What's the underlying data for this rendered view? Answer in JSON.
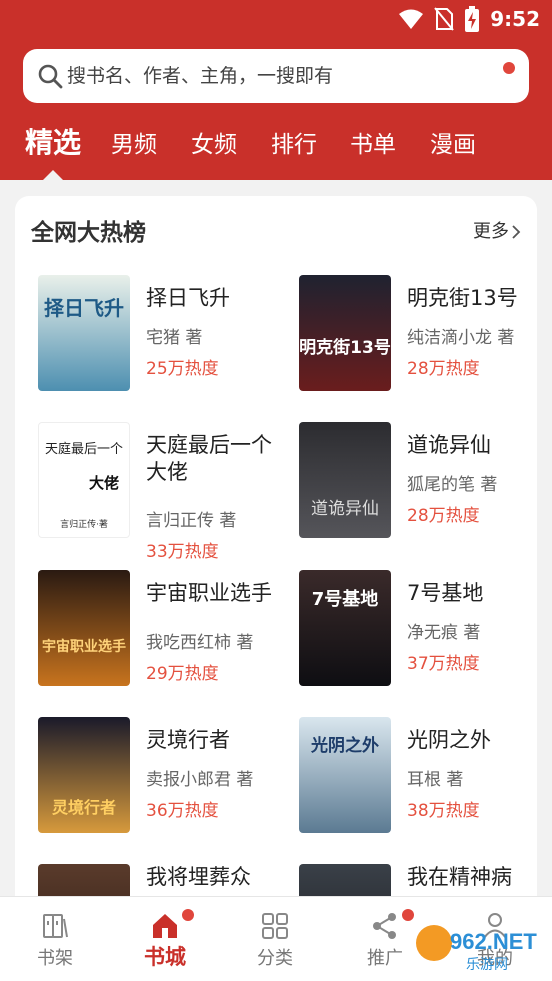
{
  "status": {
    "time": "9:52"
  },
  "search": {
    "placeholder": "搜书名、作者、主角，一搜即有"
  },
  "tabs": [
    {
      "label": "精选",
      "active": true
    },
    {
      "label": "男频"
    },
    {
      "label": "女频"
    },
    {
      "label": "排行"
    },
    {
      "label": "书单"
    },
    {
      "label": "漫画"
    }
  ],
  "section": {
    "title": "全网大热榜",
    "more": "更多"
  },
  "books": [
    {
      "title": "择日飞升",
      "author": "宅猪 著",
      "heat": "25万热度",
      "cover_text": "择日飞升",
      "cover_colors": [
        "#e9f0ea",
        "#4d8fb0"
      ]
    },
    {
      "title": "明克街13号",
      "author": "纯洁滴小龙 著",
      "heat": "28万热度",
      "cover_text": "明克街13号",
      "cover_colors": [
        "#1f2230",
        "#6a1d1d"
      ]
    },
    {
      "title": "天庭最后一个大佬",
      "author": "言归正传 著",
      "heat": "33万热度",
      "cover_text": "天庭最后一个",
      "cover_sub": "大佬",
      "cover_author": "言归正传·著",
      "cover_colors": [
        "#ffffff",
        "#ffffff"
      ]
    },
    {
      "title": "道诡异仙",
      "author": "狐尾的笔 著",
      "heat": "28万热度",
      "cover_text": "道诡异仙",
      "cover_colors": [
        "#2c2c30",
        "#55555a"
      ]
    },
    {
      "title": "宇宙职业选手",
      "author": "我吃西红柿 著",
      "heat": "29万热度",
      "cover_text": "宇宙职业选手",
      "cover_colors": [
        "#2a1a12",
        "#c8741e"
      ]
    },
    {
      "title": "7号基地",
      "author": "净无痕 著",
      "heat": "37万热度",
      "cover_text": "7号基地",
      "cover_colors": [
        "#3a2a2a",
        "#0e0e12"
      ]
    },
    {
      "title": "灵境行者",
      "author": "卖报小郎君 著",
      "heat": "36万热度",
      "cover_text": "灵境行者",
      "cover_colors": [
        "#1a1a2a",
        "#d79a3c"
      ]
    },
    {
      "title": "光阴之外",
      "author": "耳根 著",
      "heat": "38万热度",
      "cover_text": "光阴之外",
      "cover_colors": [
        "#d9e6ee",
        "#5b7a92"
      ]
    },
    {
      "title": "我将埋葬众",
      "author": "",
      "heat": "",
      "cover_text": "",
      "cover_colors": [
        "#5a3b2b",
        "#2a1a14"
      ]
    },
    {
      "title": "我在精神病",
      "author": "",
      "heat": "",
      "cover_text": "",
      "cover_colors": [
        "#3a4048",
        "#1a1c20"
      ]
    }
  ],
  "bottom_nav": [
    {
      "label": "书架",
      "icon": "bookshelf-icon"
    },
    {
      "label": "书城",
      "icon": "bookstore-icon",
      "active": true,
      "dot": true
    },
    {
      "label": "分类",
      "icon": "category-icon"
    },
    {
      "label": "推广",
      "icon": "share-icon",
      "dot": true
    },
    {
      "label": "我的",
      "icon": "profile-icon"
    }
  ],
  "watermark": {
    "brand": "962.NET",
    "sub": "乐游网"
  },
  "colors": {
    "primary": "#c9302a",
    "heat": "#e4513f",
    "dot": "#e0463c"
  }
}
